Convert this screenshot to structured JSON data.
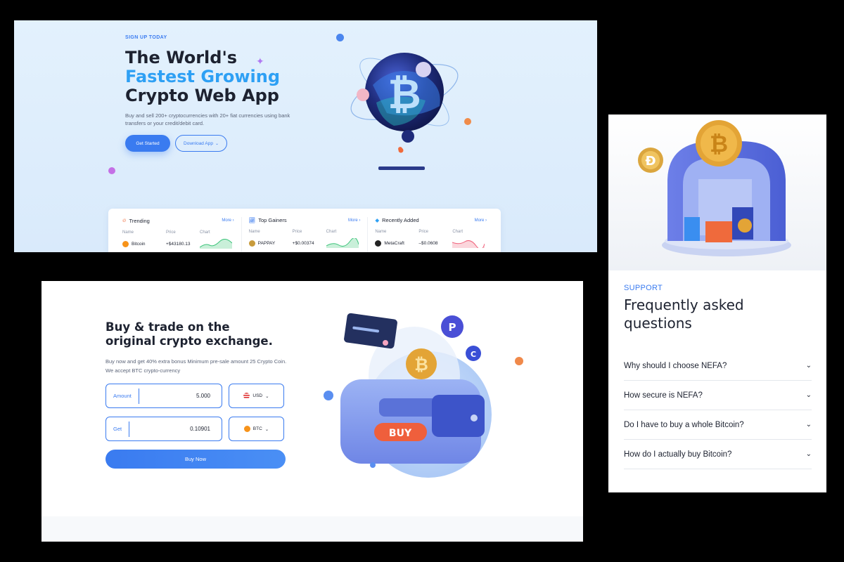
{
  "hero": {
    "eyebrow": "SIGN UP TODAY",
    "title_line1": "The World's",
    "title_line2": "Fastest Growing",
    "title_line3": "Crypto Web App",
    "description": "Buy and sell 200+ cryptocurrencies with 20+ fiat currencies using bank transfers or your credit/debit card.",
    "primary_button": "Get Started",
    "secondary_button": "Download App",
    "colors": {
      "accent": "#3a7bf0",
      "title_accent": "#2ea0f4"
    }
  },
  "market": {
    "columns": [
      {
        "title": "Trending",
        "icon": "fire-icon",
        "more": "More",
        "headers": [
          "Name",
          "Price",
          "Chart"
        ],
        "row": {
          "name": "Bitcoin",
          "price": "+$43180.13",
          "coin_color": "#f7931a",
          "trend": "up"
        }
      },
      {
        "title": "Top Gainers",
        "icon": "chart-up-icon",
        "more": "More",
        "headers": [
          "Name",
          "Price",
          "Chart"
        ],
        "row": {
          "name": "PAPPAY",
          "price": "+$0.00374",
          "coin_color": "#c89b3c",
          "trend": "up"
        }
      },
      {
        "title": "Recently Added",
        "icon": "diamond-icon",
        "more": "More",
        "headers": [
          "Name",
          "Price",
          "Chart"
        ],
        "row": {
          "name": "MetaCraft",
          "price": "–$0.0608",
          "coin_color": "#222222",
          "trend": "down"
        }
      }
    ]
  },
  "trade": {
    "title_line1": "Buy & trade on the",
    "title_line2": "original crypto exchange.",
    "description": "Buy now and get 40% extra bonus Minimum pre-sale amount 25 Crypto Coin. We accept BTC crypto-currency",
    "amount_label": "Amount",
    "amount_value": "5.000",
    "amount_currency": "USD",
    "get_label": "Get",
    "get_value": "0.10901",
    "get_currency": "BTC",
    "buy_button": "Buy Now",
    "illustration_badge": "BUY"
  },
  "faq": {
    "label": "SUPPORT",
    "title_line1": "Frequently asked",
    "title_line2": "questions",
    "items": [
      "Why should I choose NEFA?",
      "How secure is NEFA?",
      "Do I have to buy a whole Bitcoin?",
      "How do I actually buy Bitcoin?"
    ]
  }
}
